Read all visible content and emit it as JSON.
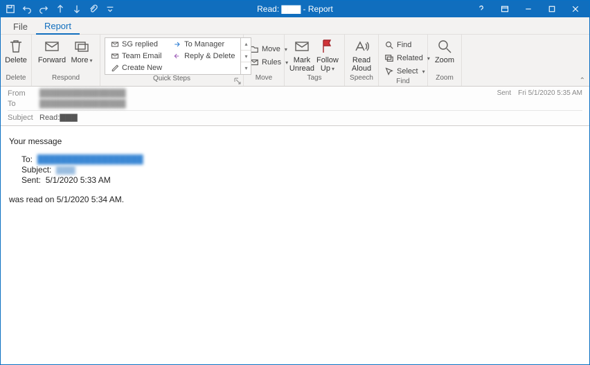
{
  "titlebar": {
    "title": "Read: ▇▇▇  - Report"
  },
  "tabs": {
    "file": "File",
    "report": "Report"
  },
  "ribbon": {
    "delete": {
      "btn": "Delete",
      "group": "Delete"
    },
    "respond": {
      "forward": "Forward",
      "more": "More",
      "group": "Respond"
    },
    "quicksteps": {
      "sg_replied": "SG replied",
      "team_email": "Team Email",
      "create_new": "Create New",
      "to_manager": "To Manager",
      "reply_delete": "Reply & Delete",
      "group": "Quick Steps"
    },
    "move": {
      "move": "Move",
      "rules": "Rules",
      "group": "Move"
    },
    "tags": {
      "mark_unread": "Mark Unread",
      "follow_up": "Follow Up",
      "group": "Tags"
    },
    "speech": {
      "read_aloud": "Read Aloud",
      "group": "Speech"
    },
    "find": {
      "find": "Find",
      "related": "Related",
      "select": "Select",
      "group": "Find"
    },
    "zoom": {
      "zoom": "Zoom",
      "group": "Zoom"
    }
  },
  "header": {
    "from_label": "From",
    "from_value": "████████████████",
    "to_label": "To",
    "to_value": "████████████████",
    "subject_label": "Subject",
    "subject_value": "Read:▇▇▇",
    "sent_label": "Sent",
    "sent_value": "Fri 5/1/2020 5:35 AM"
  },
  "body": {
    "line1": "Your message",
    "to_label": "To:",
    "to_value": "██████████████████",
    "subject_label": "Subject:",
    "subject_value": "▇▇▇",
    "sent_label": "Sent:",
    "sent_value": "5/1/2020 5:33 AM",
    "line2": "was read on 5/1/2020 5:34 AM."
  }
}
